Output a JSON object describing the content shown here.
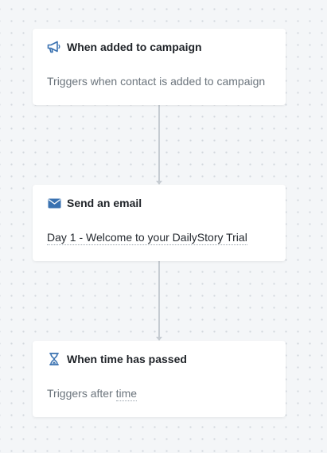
{
  "colors": {
    "icon_accent": "#3a72b1",
    "canvas_background": "#f4f6f8",
    "node_background": "#ffffff",
    "connector": "#c6ccd2"
  },
  "workflow": {
    "nodes": [
      {
        "icon": "megaphone-icon",
        "title": "When added to campaign",
        "body": "Triggers when contact is added to campaign"
      },
      {
        "icon": "envelope-icon",
        "title": "Send an email",
        "body": "Day 1 - Welcome to your DailyStory Trial"
      },
      {
        "icon": "hourglass-icon",
        "title": "When time has passed",
        "body_prefix": "Triggers after",
        "body_link": "time"
      }
    ]
  }
}
